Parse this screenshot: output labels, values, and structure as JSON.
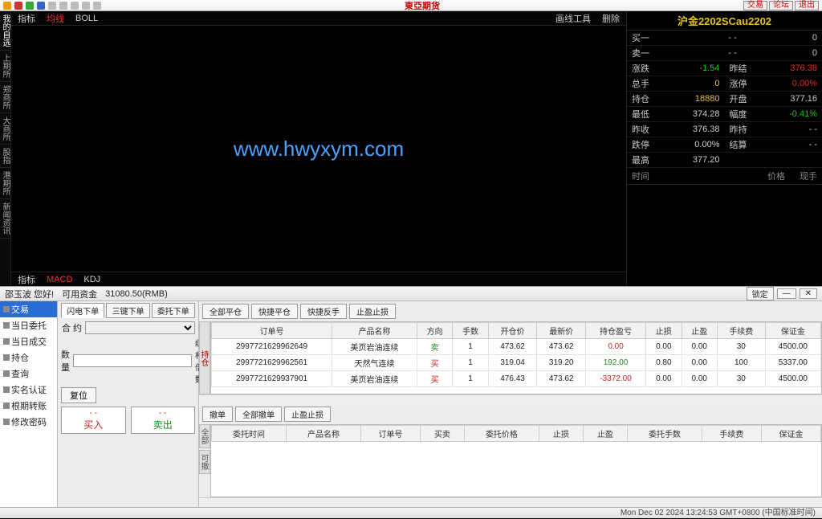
{
  "titlebar": {
    "center": "東亞期货",
    "btn_trade": "交易",
    "btn_forum": "论坛",
    "btn_exit": "退出"
  },
  "left_tabs": [
    "我的自选",
    "上期所",
    "郑商所",
    "大商所",
    "股指",
    "港期所",
    "新闻资讯"
  ],
  "ind1": {
    "a": "指标",
    "b": "均线",
    "c": "BOLL",
    "tool": "画线工具",
    "del": "删除"
  },
  "ind2": {
    "a": "指标",
    "b": "MACD",
    "c": "KDJ"
  },
  "watermark": "www.hwyxym.com",
  "quote": {
    "title": "沪金2202SCau2202",
    "rows": [
      [
        "买一",
        "- -",
        "0"
      ],
      [
        "卖一",
        "- -",
        "0"
      ]
    ],
    "pairs": [
      {
        "l1": "涨跌",
        "v1": "-1.54",
        "c1": "g",
        "l2": "昨结",
        "v2": "376.38",
        "c2": "r"
      },
      {
        "l1": "总手",
        "v1": "0",
        "c1": "y",
        "l2": "涨停",
        "v2": "0.00%",
        "c2": "r"
      },
      {
        "l1": "持仓",
        "v1": "18880",
        "c1": "y",
        "l2": "开盘",
        "v2": "377.16",
        "c2": ""
      },
      {
        "l1": "最低",
        "v1": "374.28",
        "c1": "",
        "l2": "幅度",
        "v2": "-0.41%",
        "c2": "g"
      },
      {
        "l1": "昨收",
        "v1": "376.38",
        "c1": "",
        "l2": "昨持",
        "v2": "- -",
        "c2": ""
      },
      {
        "l1": "跌停",
        "v1": "0.00%",
        "c1": "",
        "l2": "结算",
        "v2": "- -",
        "c2": ""
      },
      {
        "l1": "最高",
        "v1": "377.20",
        "c1": "",
        "l2": "",
        "v2": "",
        "c2": ""
      }
    ],
    "head2": {
      "a": "时间",
      "b": "价格",
      "c": "现手"
    }
  },
  "lower_top": {
    "greet": "邵玉波 您好!",
    "funds_label": "可用资金",
    "funds": "31080.50(RMB)",
    "lock": "锁定"
  },
  "menu": [
    "交易",
    "当日委托",
    "当日成交",
    "持仓",
    "查询",
    "实名认证",
    "根期转账",
    "修改密码"
  ],
  "order": {
    "tabs": [
      "闪电下单",
      "三键下单",
      "委托下单"
    ],
    "f_contract": "合   约",
    "f_qty": "数   量",
    "f_mult": "红杆倍数",
    "btn_reset": "复位",
    "buy": "买入",
    "sell": "卖出",
    "price": "- -"
  },
  "dc_tabs1": [
    "全部平仓",
    "快捷平仓",
    "快捷反手",
    "止盈止损"
  ],
  "pos_side": "持仓",
  "pos_headers": [
    "订单号",
    "产品名称",
    "方向",
    "手数",
    "开仓价",
    "最新价",
    "持仓盈亏",
    "止损",
    "止盈",
    "手续费",
    "保证金"
  ],
  "pos_rows": [
    [
      "2997721629962649",
      "美页岩油连续",
      "卖",
      "1",
      "473.62",
      "473.62",
      "0.00",
      "0.00",
      "0.00",
      "30",
      "4500.00"
    ],
    [
      "2997721629962561",
      "天然气连续",
      "买",
      "1",
      "319.04",
      "319.20",
      "192.00",
      "0.80",
      "0.00",
      "100",
      "5337.00"
    ],
    [
      "2997721629937901",
      "美页岩油连续",
      "买",
      "1",
      "476.43",
      "473.62",
      "-3372.00",
      "0.00",
      "0.00",
      "30",
      "4500.00"
    ]
  ],
  "dc_tabs2": [
    "撤单",
    "全部撤单",
    "止盈止损"
  ],
  "ord_side_a": "全部",
  "ord_side_b": "可撤",
  "ord_headers": [
    "委托时间",
    "产品名称",
    "订单号",
    "买卖",
    "委托价格",
    "止损",
    "止盈",
    "委托手数",
    "手续费",
    "保证金"
  ],
  "status": "Mon Dec 02 2024 13:24:53 GMT+0800 (中国标准时间)"
}
